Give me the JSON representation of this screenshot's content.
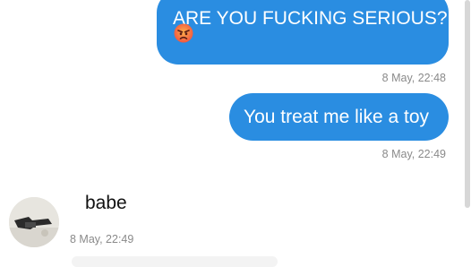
{
  "messages": [
    {
      "direction": "outgoing",
      "text": "ARE YOU FUCKING SERIOUS?",
      "emoji": "angry-face",
      "time": "8 May, 22:48"
    },
    {
      "direction": "outgoing",
      "text": "You treat me like a toy",
      "time": "8 May, 22:49"
    },
    {
      "direction": "incoming",
      "text": "babe",
      "time": "8 May, 22:49"
    }
  ],
  "colors": {
    "outgoing_bubble": "#2a8de1",
    "outgoing_text": "#ffffff",
    "incoming_text": "#111111",
    "timestamp": "#8a8a8a"
  }
}
